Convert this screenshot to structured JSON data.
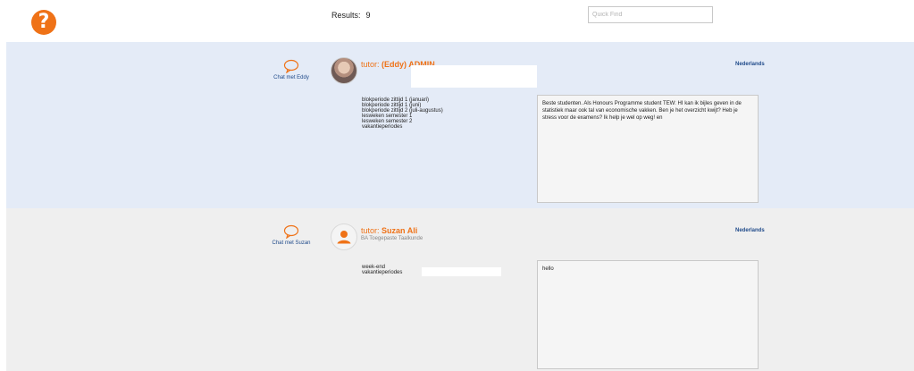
{
  "header": {
    "help_icon": "question-mark-icon",
    "results_label": "Results:",
    "results_count": "9",
    "quick_find_placeholder": "Quick Find",
    "quick_find_value": ""
  },
  "colors": {
    "accent_orange": "#ef7217",
    "link_blue": "#1f4a8a",
    "card_blue": "#e4ebf7",
    "card_grey": "#efefef"
  },
  "tutors": [
    {
      "chat_label": "Chat met Eddy",
      "tutor_prefix": "tutor:",
      "name": "(Eddy) ADMIN",
      "subtitle": "",
      "language": "Nederlands",
      "periods": [
        "blokperiode zittijd 1 (januari)",
        "blokperiode zittijd 1 (juni)",
        "blokperiode zittijd 2 (juli-augustus)",
        "lesweken semester 1",
        "lesweken semester 2",
        "vakantieperiodes"
      ],
      "bio": "Beste studenten.  Als Honours Programme student TEW: HI kan ik bijles geven in de statistiek maar ook tal van economische vakken. Ben je het overzicht kwijt? Heb je stress voor de examens? Ik help je wel op weg! en"
    },
    {
      "chat_label": "Chat met Suzan",
      "tutor_prefix": "tutor:",
      "name": "Suzan Ali",
      "subtitle": "BA Toegepaste Taalkunde",
      "language": "Nederlands",
      "periods": [
        "week-end",
        "vakantieperiodes"
      ],
      "bio": "hello"
    }
  ]
}
